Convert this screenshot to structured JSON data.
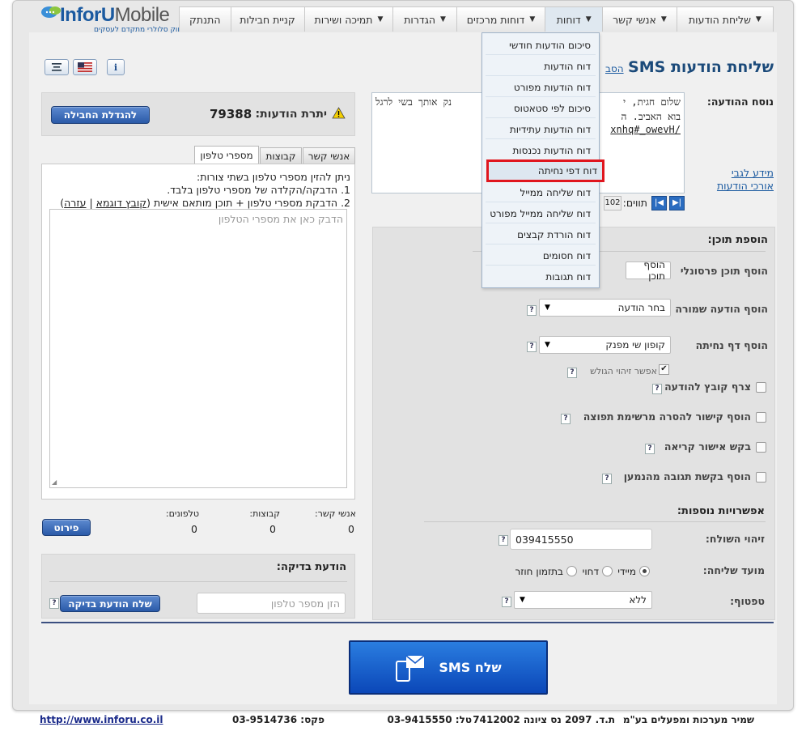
{
  "brand": {
    "name_a": "Infor",
    "name_b": "U",
    "name_c": "Mobile",
    "tagline": "שיווק סלולרי מתקדם לעסקים"
  },
  "nav": [
    {
      "label": "שליחת הודעות",
      "caret": true
    },
    {
      "label": "אנשי קשר",
      "caret": true
    },
    {
      "label": "דוחות",
      "caret": true,
      "active": true
    },
    {
      "label": "דוחות מרכזים",
      "caret": true
    },
    {
      "label": "הגדרות",
      "caret": true
    },
    {
      "label": "תמיכה ושירות",
      "caret": true
    },
    {
      "label": "קניית חבילות",
      "caret": false
    },
    {
      "label": "התנתק",
      "caret": false
    }
  ],
  "menu_items": [
    "סיכום הודעות חודשי",
    "דוח הודעות",
    "דוח הודעות מפורט",
    "סיכום לפי סטאטוס",
    "דוח הודעות עתידיות",
    "דוח הודעות נכנסות",
    "דוח דפי נחיתה",
    "דוח שליחה ממייל",
    "דוח שליחה ממייל מפורט",
    "דוח הורדת קבצים",
    "דוח חסומים",
    "דוח תגובות"
  ],
  "menu_highlight_index": 6,
  "page": {
    "title": "שליחת הודעות SMS",
    "help_link": "הסב"
  },
  "balance": {
    "label": "יתרת הודעות:",
    "value": "79388",
    "button": "להגדלת החבילה"
  },
  "message": {
    "label": "נוסח ההודעה:",
    "line1": "שלום חגית, י",
    "line1b": "נק אותך בשי לרגל",
    "line2": "בוא האביב. ה",
    "line3": "xnhq#_owevH/",
    "chars_label": "תווים:",
    "chars_value": "102",
    "link": "מידע לגבי אורכי הודעות"
  },
  "tabs": [
    "אנשי קשר",
    "קבוצות",
    "מספרי טלפון"
  ],
  "phones": {
    "intro": "ניתן להזין מספרי טלפון בשתי צורות:",
    "opt1": "1. הדבקה/הקלדה של מספרי טלפון בלבד.",
    "opt2": "2. הדבקת מספרי טלפון + תוכן מותאם אישית (",
    "sample_link": "קובץ דוגמא",
    "sep": " | ",
    "help_link": "עזרה",
    "close": ")",
    "placeholder": "הדבק כאן את מספרי הטלפון"
  },
  "counts": {
    "contacts_label": "אנשי קשר:",
    "groups_label": "קבוצות:",
    "phones_label": "טלפונים:",
    "contacts": "0",
    "groups": "0",
    "phones": "0",
    "details_button": "פירוט"
  },
  "test": {
    "title": "הודעת בדיקה:",
    "placeholder": "הזן מספר טלפון",
    "button": "שלח הודעת בדיקה"
  },
  "content": {
    "title": "הוספת תוכן:",
    "personal_label": "הוסף תוכן פרסונלי",
    "personal_value": "הוסף תוכן",
    "saved_label": "הוסף הודעה שמורה",
    "saved_value": "בחר הודעה",
    "landing_label": "הוסף דף נחיתה",
    "landing_value": "קופון שי מפנק",
    "identify_label": "אפשר זיהוי הגולש",
    "attach_label": "צרף קובץ להודעה",
    "unsub_label": "הוסף קישור להסרה מרשימת תפוצה",
    "read_label": "בקש אישור קריאה",
    "reply_label": "הוסף בקשת תגובה מהנמען"
  },
  "options": {
    "title": "אפשרויות נוספות:",
    "sender_label": "זיהוי השולח:",
    "sender_value": "039415550",
    "timing_label": "מועד שליחה:",
    "immediate": "מיידי",
    "delayed": "דחוי",
    "recurring": "בתזמון חוזר",
    "fill_label": "טפטוף:",
    "fill_value": "ללא"
  },
  "send_button": "שלח SMS",
  "footer": {
    "company": "שמיר מערכות ומפעלים בע\"מ",
    "address": "ת.ד. 2097 נס ציונה 7412002",
    "tel": "טל: 03-9415550",
    "fax": "פקס: 03-9514736",
    "url": "http://www.inforu.co.il"
  },
  "colors": {
    "accent": "#1b5aa0",
    "highlight": "#e0161e",
    "button": "#2a5aa8"
  }
}
